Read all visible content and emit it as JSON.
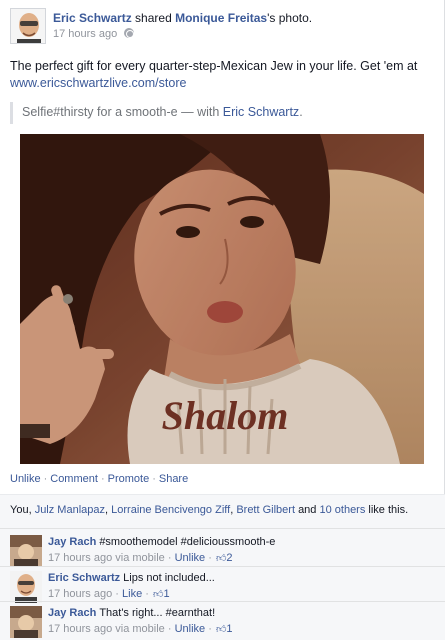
{
  "post": {
    "author": "Eric Schwartz",
    "shared_text": "shared",
    "shared_from": "Monique Freitas",
    "shared_suffix": "'s photo.",
    "timestamp": "17 hours ago",
    "privacy_icon": "globe-icon",
    "message_text": "The perfect gift for every quarter-step-Mexican Jew in your life. Get 'em at",
    "message_link": "www.ericschwartzlive.com/store",
    "quote_text": "Selfie#thirsty for a smooth-e — with",
    "quote_tag": "Eric Schwartz",
    "quote_end": ".",
    "photo_shirt_text": "Shalom"
  },
  "actions": {
    "unlike": "Unlike",
    "comment": "Comment",
    "promote": "Promote",
    "share": "Share",
    "separator": "·"
  },
  "likes": {
    "prefix": "You,",
    "people": [
      "Julz Manlapaz",
      "Lorraine Bencivengo Ziff",
      "Brett Gilbert"
    ],
    "sep1": ",",
    "sep2": ",",
    "and": "and",
    "others": "10 others",
    "suffix": "like this."
  },
  "comments": [
    {
      "author": "Jay Rach",
      "text": "#smoothemodel #delicioussmooth-e",
      "time": "17 hours ago via mobile",
      "action": "Unlike",
      "likes": "2"
    },
    {
      "author": "Eric Schwartz",
      "text": "Lips not included...",
      "time": "17 hours ago",
      "action": "Like",
      "likes": "1"
    },
    {
      "author": "Jay Rach",
      "text": "That's right... #earnthat!",
      "time": "17 hours ago via mobile",
      "action": "Unlike",
      "likes": "1"
    }
  ],
  "comment_sep": "·",
  "colors": {
    "link": "#3b5998",
    "meta": "#90949c",
    "ufi_bg": "#f6f7f9"
  }
}
